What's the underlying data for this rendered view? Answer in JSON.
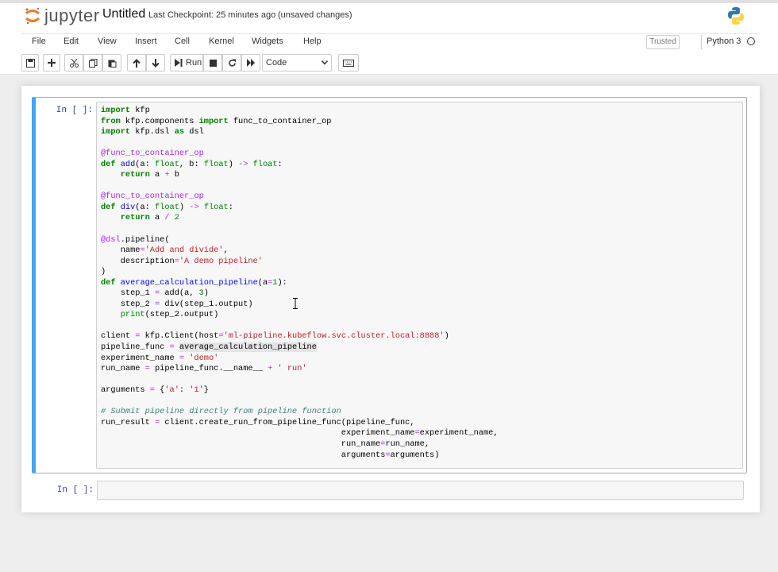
{
  "header": {
    "logo_text": "jupyter",
    "title": "Untitled",
    "checkpoint": "Last Checkpoint: 25 minutes ago",
    "unsaved": "(unsaved changes)"
  },
  "menu": [
    "File",
    "Edit",
    "View",
    "Insert",
    "Cell",
    "Kernel",
    "Widgets",
    "Help"
  ],
  "status": {
    "trusted": "Trusted",
    "kernel": "Python 3"
  },
  "toolbar": {
    "run_label": "Run",
    "cell_type": "Code"
  },
  "cells": [
    {
      "prompt": "In [ ]:"
    },
    {
      "prompt": "In [ ]:"
    }
  ],
  "colors": {
    "accent": "#42a5f5",
    "prompt": "#303f9f",
    "logo_orange": "#f37726"
  }
}
